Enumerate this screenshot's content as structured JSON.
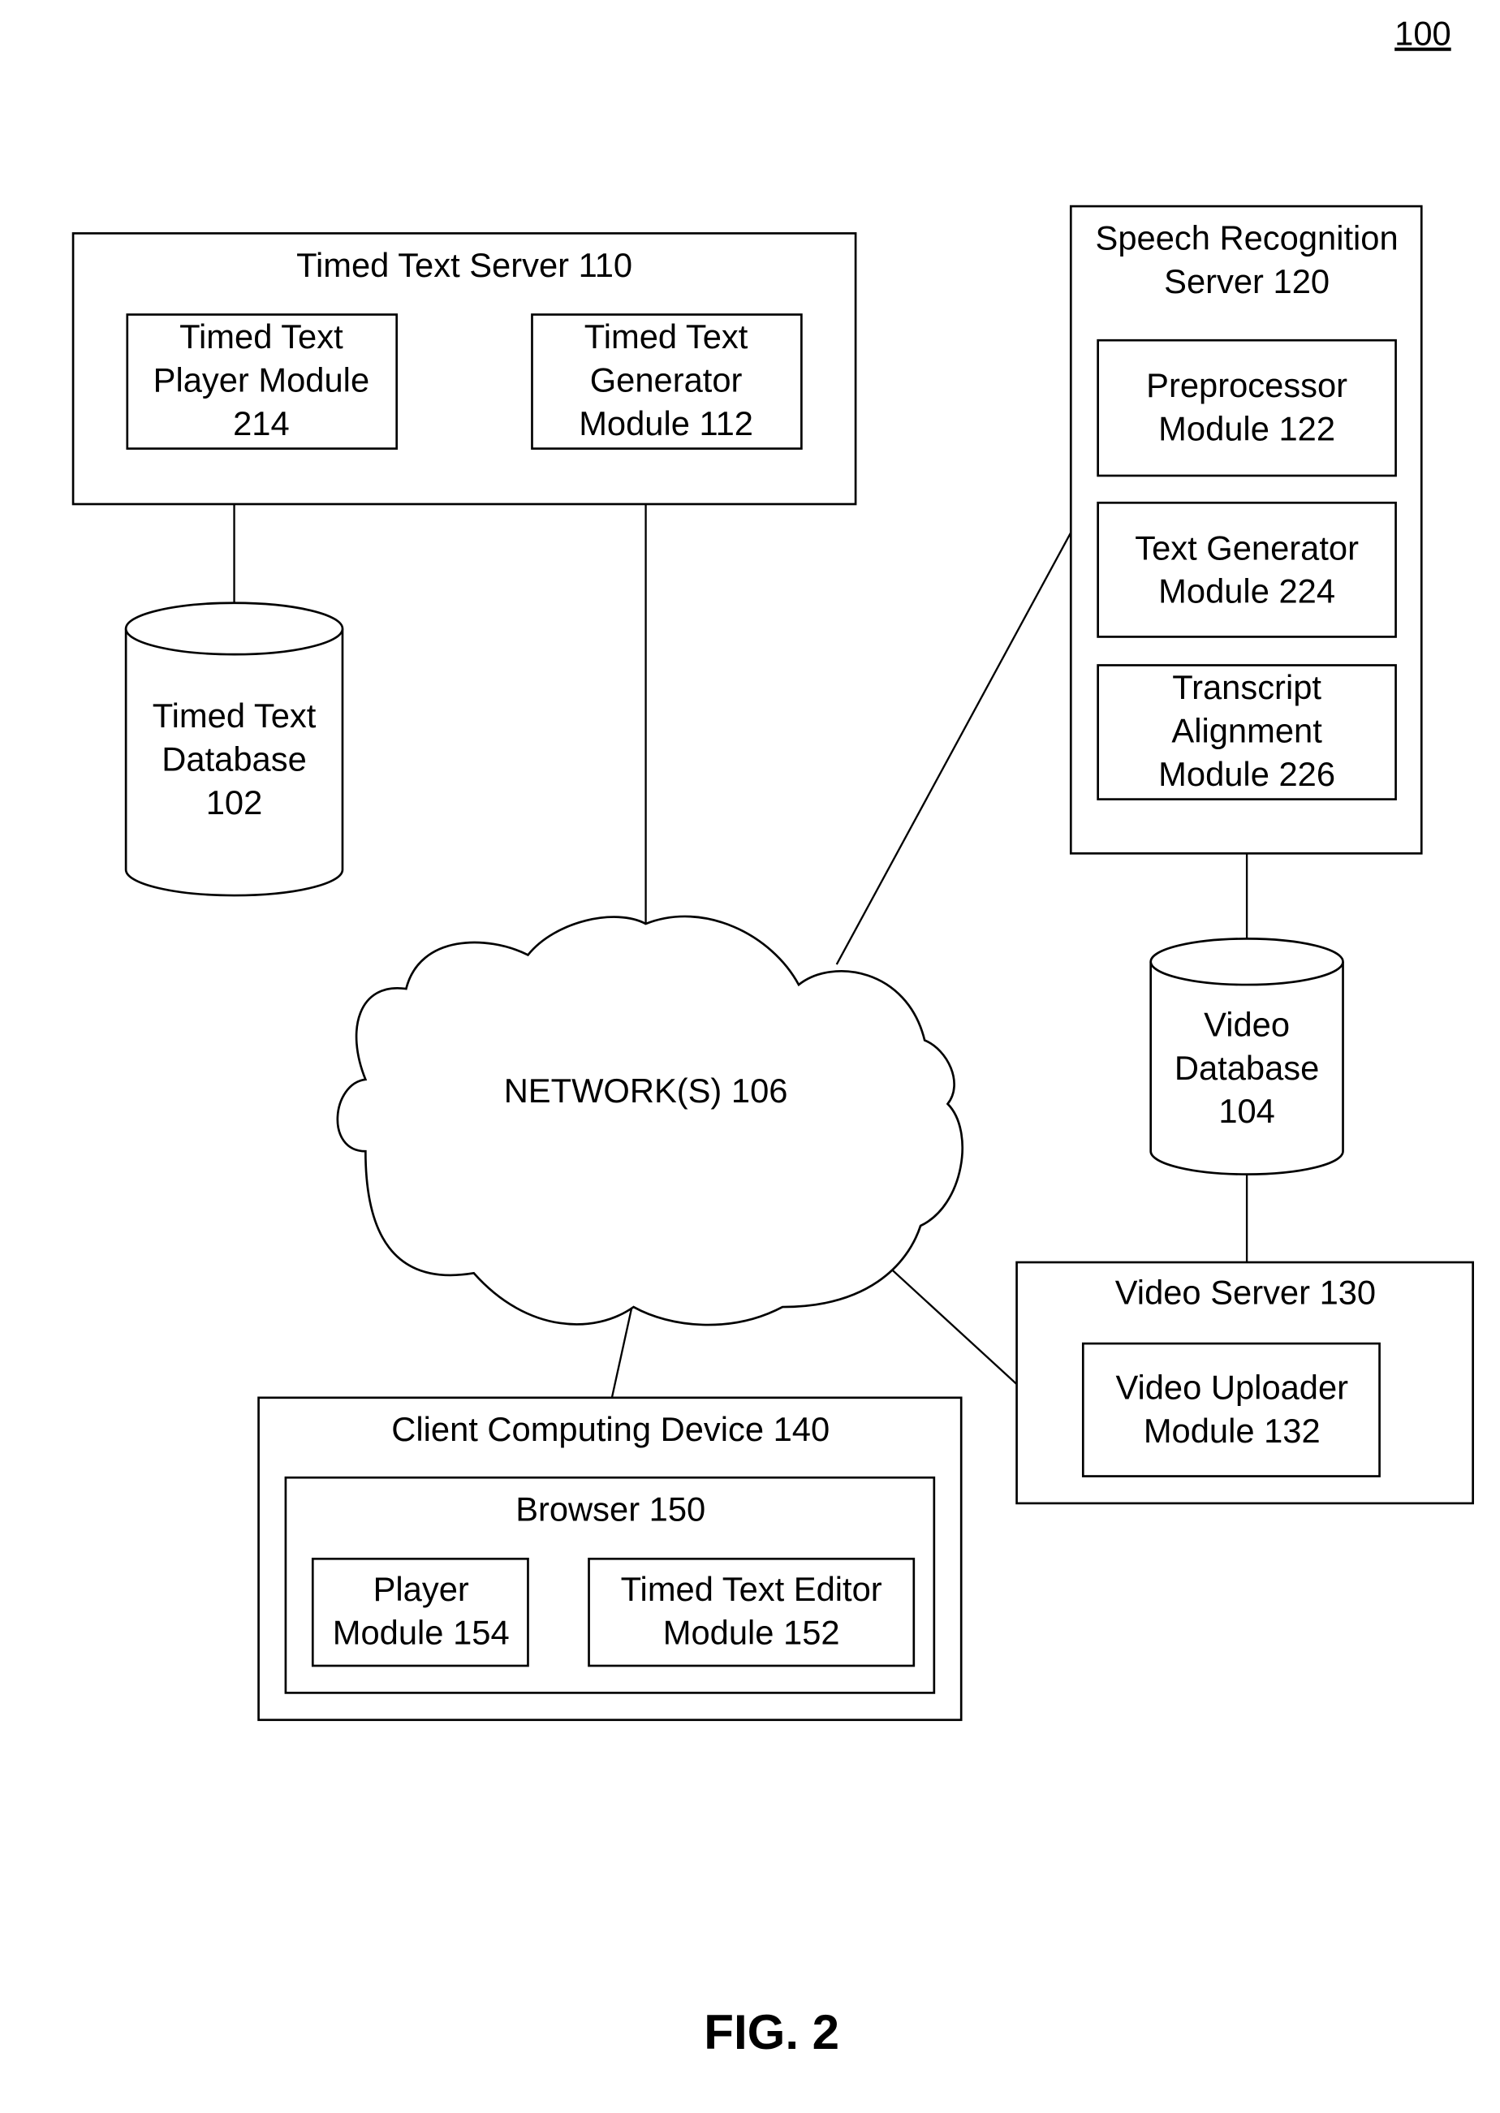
{
  "figure_ref": "100",
  "figure_caption": "FIG. 2",
  "timed_text_server": {
    "title": "Timed Text Server 110",
    "player_module": [
      "Timed Text",
      "Player Module",
      "214"
    ],
    "generator_module": [
      "Timed Text",
      "Generator",
      "Module 112"
    ]
  },
  "timed_text_database": [
    "Timed Text",
    "Database",
    "102"
  ],
  "speech_recognition_server": {
    "title": [
      "Speech Recognition",
      "Server 120"
    ],
    "preprocessor_module": [
      "Preprocessor",
      "Module 122"
    ],
    "text_generator_module": [
      "Text Generator",
      "Module 224"
    ],
    "transcript_alignment_module": [
      "Transcript",
      "Alignment",
      "Module 226"
    ]
  },
  "video_database": [
    "Video",
    "Database",
    "104"
  ],
  "network": "NETWORK(S) 106",
  "video_server": {
    "title": "Video Server 130",
    "uploader_module": [
      "Video Uploader",
      "Module 132"
    ]
  },
  "client_device": {
    "title": "Client Computing Device 140",
    "browser": {
      "title": "Browser 150",
      "player_module": [
        "Player",
        "Module 154"
      ],
      "editor_module": [
        "Timed Text Editor",
        "Module 152"
      ]
    }
  }
}
